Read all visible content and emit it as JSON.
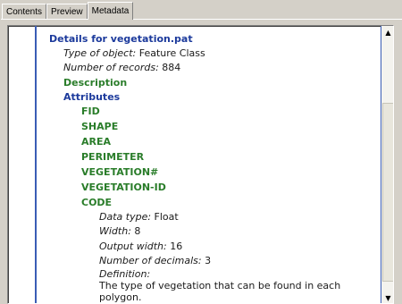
{
  "tabs": [
    "Contents",
    "Preview",
    "Metadata"
  ],
  "active_tab": "Metadata",
  "details_title": "Details for vegetation.pat",
  "type_label": "Type of object:",
  "type_value": "Feature Class",
  "records_label": "Number of records:",
  "records_value": "884",
  "description_heading": "Description",
  "attributes_heading": "Attributes",
  "attributes": [
    "FID",
    "SHAPE",
    "AREA",
    "PERIMETER",
    "VEGETATION#",
    "VEGETATION-ID",
    "CODE"
  ],
  "code_details": {
    "data_type_label": "Data type:",
    "data_type_value": "Float",
    "width_label": "Width:",
    "width_value": "8",
    "output_width_label": "Output width:",
    "output_width_value": "16",
    "decimals_label": "Number of decimals:",
    "decimals_value": "3",
    "definition_label": "Definition:",
    "definition_line1": "The type of vegetation that can be found in each",
    "definition_line2": "polygon."
  }
}
